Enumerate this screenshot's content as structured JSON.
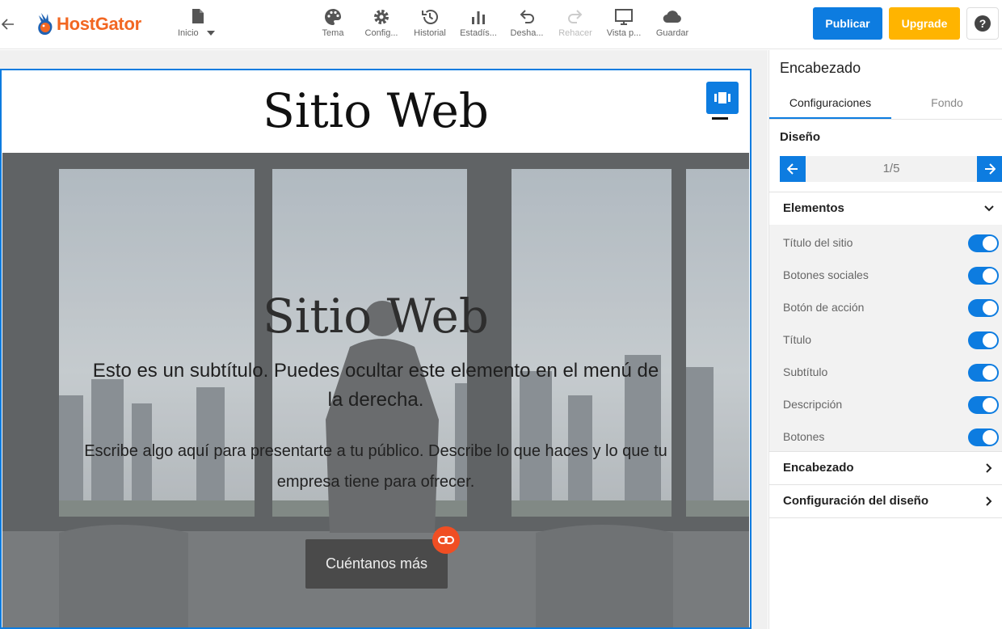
{
  "app": {
    "brand": "HostGator",
    "page_selector": "Inicio"
  },
  "toolbar": {
    "items": [
      {
        "label": "Tema",
        "icon": "palette-icon"
      },
      {
        "label": "Config...",
        "icon": "gear-icon"
      },
      {
        "label": "Historial",
        "icon": "history-icon"
      },
      {
        "label": "Estadís...",
        "icon": "bar-chart-icon"
      },
      {
        "label": "Desha...",
        "icon": "undo-icon"
      },
      {
        "label": "Rehacer",
        "icon": "redo-icon",
        "disabled": true
      },
      {
        "label": "Vista p...",
        "icon": "monitor-icon"
      },
      {
        "label": "Guardar",
        "icon": "cloud-icon"
      }
    ],
    "publish": "Publicar",
    "upgrade": "Upgrade",
    "help": "?"
  },
  "canvas": {
    "site_title": "Sitio Web",
    "hero_title": "Sitio Web",
    "hero_subtitle": "Esto es un subtítulo. Puedes ocultar este elemento en el menú de la derecha.",
    "hero_description": "Escribe algo aquí para presentarte a tu público. Describe lo que haces y lo que tu empresa tiene para ofrecer.",
    "cta_label": "Cuéntanos más"
  },
  "panel": {
    "title": "Encabezado",
    "tabs": [
      "Configuraciones",
      "Fondo"
    ],
    "active_tab": "Configuraciones",
    "design_label": "Diseño",
    "design_page": "1/5",
    "sections": {
      "elements": "Elementos",
      "header": "Encabezado",
      "layout": "Configuración del diseño"
    },
    "toggles": [
      {
        "label": "Título del sitio",
        "on": true
      },
      {
        "label": "Botones sociales",
        "on": true
      },
      {
        "label": "Botón de acción",
        "on": true
      },
      {
        "label": "Título",
        "on": true
      },
      {
        "label": "Subtítulo",
        "on": true
      },
      {
        "label": "Descripción",
        "on": true
      },
      {
        "label": "Botones",
        "on": true
      }
    ]
  },
  "colors": {
    "accent": "#0d7ce0",
    "upgrade": "#ffb400",
    "brand": "#f26722",
    "link_badge": "#f04e23"
  }
}
